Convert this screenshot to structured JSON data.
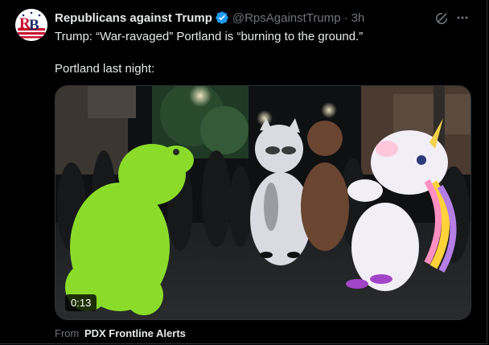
{
  "tweet": {
    "display_name": "Republicans against Trump",
    "handle": "@RpsAgainstTrump",
    "separator": "·",
    "time": "3h",
    "line1": "Trump: “War-ravaged” Portland is “burning to the ground.”",
    "line2": "Portland last night:",
    "avatar_text": "RB",
    "verified_icon": "verified-badge-icon",
    "more_icon": "more-options-icon",
    "grok_icon": "grok-icon"
  },
  "media": {
    "duration": "0:13"
  },
  "attribution": {
    "prefix": "From",
    "source": "PDX Frontline Alerts"
  },
  "colors": {
    "background": "#000000",
    "text": "#e7e9ea",
    "muted": "#71767b",
    "verified": "#1d9bf0",
    "border": "#2f3336"
  }
}
